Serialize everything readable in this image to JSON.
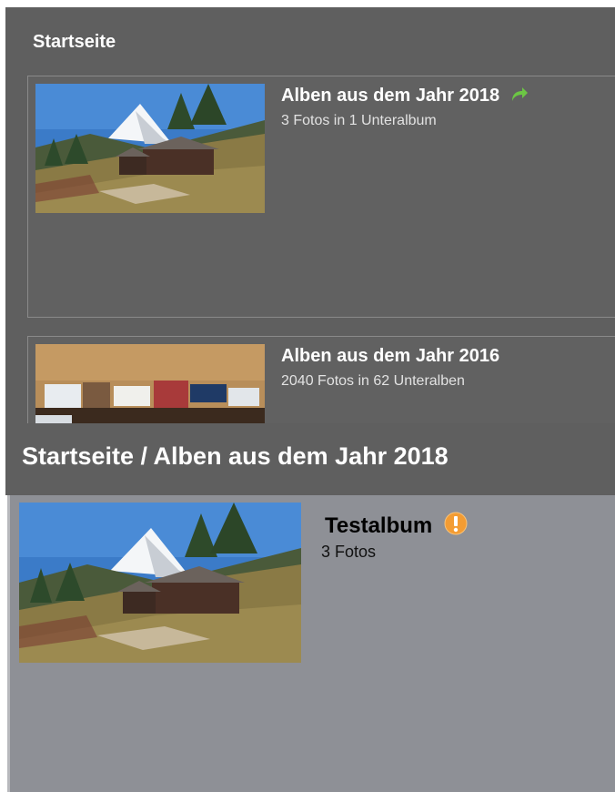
{
  "top_panel": {
    "breadcrumb": "Startseite",
    "albums": [
      {
        "title": "Alben aus dem Jahr 2018",
        "subtitle": "3 Fotos in 1 Unteralbum",
        "icon": "share-arrow-icon",
        "thumb": "mountain-hut-photo"
      },
      {
        "title": "Alben aus dem Jahr 2016",
        "subtitle": "2040 Fotos in 62 Unteralben",
        "thumb": "books-photo"
      }
    ]
  },
  "bottom_panel": {
    "breadcrumb": "Startseite / Alben aus dem Jahr 2018",
    "album": {
      "title": "Testalbum",
      "subtitle": "3 Fotos",
      "icon": "warning-icon",
      "thumb": "mountain-hut-photo"
    }
  },
  "colors": {
    "dark_panel": "#5f5f5f",
    "light_panel": "#8e9096",
    "share_green": "#6cc644",
    "warning_orange": "#f39c33"
  }
}
